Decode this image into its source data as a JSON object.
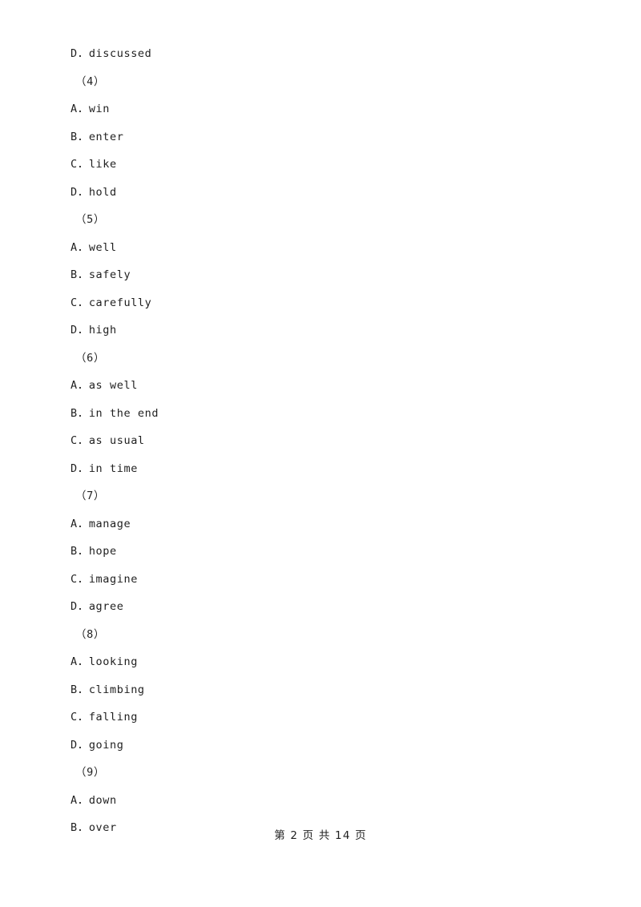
{
  "page": {
    "background_color": "#ffffff",
    "text_color": "#1f1f1f"
  },
  "content": {
    "lines": [
      {
        "kind": "option",
        "text": "D．discussed"
      },
      {
        "kind": "qnum",
        "text": "（4）"
      },
      {
        "kind": "option",
        "text": "A．win"
      },
      {
        "kind": "option",
        "text": "B．enter"
      },
      {
        "kind": "option",
        "text": "C．like"
      },
      {
        "kind": "option",
        "text": "D．hold"
      },
      {
        "kind": "qnum",
        "text": "（5）"
      },
      {
        "kind": "option",
        "text": "A．well"
      },
      {
        "kind": "option",
        "text": "B．safely"
      },
      {
        "kind": "option",
        "text": "C．carefully"
      },
      {
        "kind": "option",
        "text": "D．high"
      },
      {
        "kind": "qnum",
        "text": "（6）"
      },
      {
        "kind": "option",
        "text": "A．as well"
      },
      {
        "kind": "option",
        "text": "B．in the end"
      },
      {
        "kind": "option",
        "text": "C．as usual"
      },
      {
        "kind": "option",
        "text": "D．in time"
      },
      {
        "kind": "qnum",
        "text": "（7）"
      },
      {
        "kind": "option",
        "text": "A．manage"
      },
      {
        "kind": "option",
        "text": "B．hope"
      },
      {
        "kind": "option",
        "text": "C．imagine"
      },
      {
        "kind": "option",
        "text": "D．agree"
      },
      {
        "kind": "qnum",
        "text": "（8）"
      },
      {
        "kind": "option",
        "text": "A．looking"
      },
      {
        "kind": "option",
        "text": "B．climbing"
      },
      {
        "kind": "option",
        "text": "C．falling"
      },
      {
        "kind": "option",
        "text": "D．going"
      },
      {
        "kind": "qnum",
        "text": "（9）"
      },
      {
        "kind": "option",
        "text": "A．down"
      },
      {
        "kind": "option",
        "text": "B．over"
      }
    ]
  },
  "footer": {
    "text": "第 2 页 共 14 页",
    "current_page": "2",
    "total_pages": "14"
  }
}
